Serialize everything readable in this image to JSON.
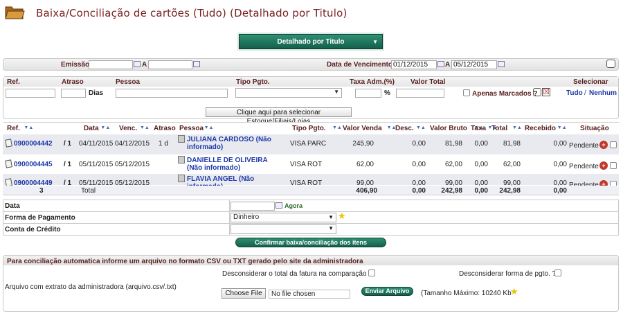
{
  "page": {
    "title": "Baixa/Conciliação de cartões (Tudo) (Detalhado por Titulo)",
    "mode_label": "Detalhado por Titulo"
  },
  "filters": {
    "emissao_label": "Emissão:",
    "a_label": "A",
    "vencimento_label": "Data de Vencimento:",
    "venc_from": "01/12/2015",
    "venc_to": "05/12/2015"
  },
  "filters2": {
    "ref": "Ref.",
    "atraso": "Atraso",
    "dias": "Dias",
    "pessoa": "Pessoa",
    "tipo_pgto": "Tipo Pgto.",
    "taxa_adm": "Taxa Adm.(%)",
    "pct": "%",
    "valor_total": "Valor Total",
    "selecionar": "Selecionar",
    "apenas_marcados": "Apenas Marcados ?",
    "tudo": "Tudo",
    "slash": "/",
    "nenhum": "Nenhum",
    "estoque_button": "Clique aqui para selecionar Estoque/Filiais/Lojas"
  },
  "grid": {
    "headers": [
      "Ref.",
      "Data",
      "Venc.",
      "Atraso",
      "Pessoa",
      "Tipo Pgto.",
      "Valor Venda",
      "Desc.",
      "Valor Bruto",
      "Taxa",
      "Total",
      "Recebido",
      "Situação"
    ],
    "rows": [
      {
        "ref": "0900004442",
        "parcela": "/ 1",
        "data": "04/11/2015",
        "venc": "04/12/2015",
        "atraso": "1 d",
        "pessoa": "JULIANA CARDOSO (Não informado)",
        "tipo": "VISA PARC",
        "venda": "245,90",
        "desc": "0,00",
        "bruto": "81,98",
        "taxa": "0,00",
        "total": "81,98",
        "recebido": "0,00",
        "situacao": "Pendente"
      },
      {
        "ref": "0900004445",
        "parcela": "/ 1",
        "data": "05/11/2015",
        "venc": "05/12/2015",
        "atraso": "",
        "pessoa": "DANIELLE DE OLIVEIRA (Não informado)",
        "tipo": "VISA ROT",
        "venda": "62,00",
        "desc": "0,00",
        "bruto": "62,00",
        "taxa": "0,00",
        "total": "62,00",
        "recebido": "0,00",
        "situacao": "Pendente"
      },
      {
        "ref": "0900004449",
        "parcela": "/ 1",
        "data": "05/11/2015",
        "venc": "05/12/2015",
        "atraso": "",
        "pessoa": "FLAVIA ANGEL (Não informado)",
        "tipo": "VISA ROT",
        "venda": "99,00",
        "desc": "0,00",
        "bruto": "99,00",
        "taxa": "0,00",
        "total": "99,00",
        "recebido": "0,00",
        "situacao": "Pendente"
      }
    ],
    "totals": {
      "count": "3",
      "label": "Total",
      "venda": "406,90",
      "desc": "0,00",
      "bruto": "242,98",
      "taxa": "0,00",
      "total": "242,98",
      "recebido": "0,00"
    },
    "plus_symbol": "+"
  },
  "form": {
    "data_label": "Data",
    "agora": "Agora",
    "forma_label": "Forma de Pagamento",
    "forma_value": "Dinheiro",
    "conta_label": "Conta de Crédito",
    "confirm_button": "Confirmar baixa/conciliação dos itens selecionados"
  },
  "import": {
    "header": "Para conciliação automatica informe um arquivo no formato CSV ou TXT gerado pelo site da administradora",
    "desconsiderar_total": "Desconsiderar o total da fatura na comparação ?",
    "desconsiderar_forma": "Desconsiderar forma de pgto. ?",
    "arquivo_label": "Arquivo com extrato da administradora (arquivo.csv/.txt)",
    "choose_file": "Choose File",
    "no_file": "No file chosen",
    "enviar": "Enviar Arquivo",
    "tamanho": "(Tamanho Máximo: 10240 Kb"
  }
}
